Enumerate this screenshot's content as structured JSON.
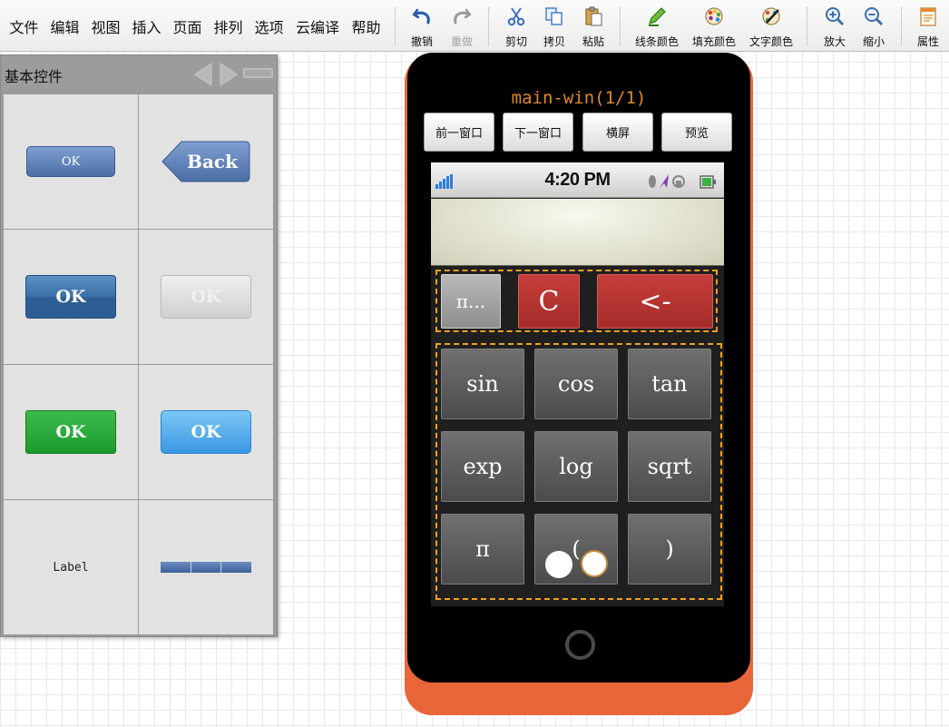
{
  "menu": [
    "文件",
    "编辑",
    "视图",
    "插入",
    "页面",
    "排列",
    "选项",
    "云编译",
    "帮助"
  ],
  "toolbar": {
    "undo": "撤销",
    "redo": "重做",
    "cut": "剪切",
    "copy": "拷贝",
    "paste": "粘贴",
    "line_color": "线条颜色",
    "fill_color": "填充颜色",
    "text_color": "文字颜色",
    "zoom_in": "放大",
    "zoom_out": "缩小",
    "properties": "属性"
  },
  "palette": {
    "title": "基本控件",
    "widgets": {
      "ok_small": "OK",
      "back": "Back",
      "ok_blue": "OK",
      "ok_disabled": "OK",
      "ok_green": "OK",
      "ok_light": "OK",
      "label": "Label"
    }
  },
  "window": {
    "title": "main-win(1/1)",
    "prev": "前一窗口",
    "next": "下一窗口",
    "landscape": "横屏",
    "preview": "预览"
  },
  "status_bar": {
    "time": "4:20 PM"
  },
  "calculator": {
    "display_value": "",
    "row_top": {
      "pi_more": "π...",
      "clear": "C",
      "backspace": "<-"
    },
    "keys": [
      [
        "sin",
        "cos",
        "tan"
      ],
      [
        "exp",
        "log",
        "sqrt"
      ],
      [
        "π",
        "(",
        ")"
      ]
    ]
  },
  "colors": {
    "accent_orange": "#e8663a",
    "selection": "#f0a020",
    "key_red": "#b83533"
  }
}
